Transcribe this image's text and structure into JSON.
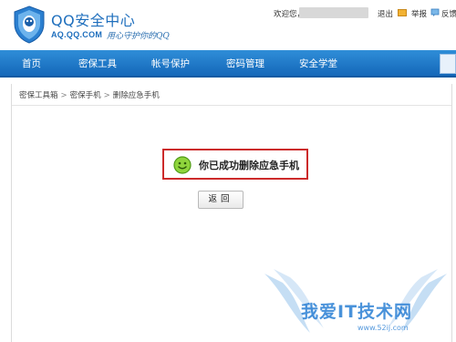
{
  "header": {
    "title": "QQ安全中心",
    "domain": "AQ.QQ.COM",
    "slogan": "用心守护你的QQ",
    "welcome": "欢迎您，",
    "logout": "退出",
    "report": "举报",
    "feedback": "反馈建议"
  },
  "nav": {
    "items": [
      {
        "label": "首页"
      },
      {
        "label": "密保工具"
      },
      {
        "label": "帐号保护"
      },
      {
        "label": "密码管理"
      },
      {
        "label": "安全学堂"
      }
    ]
  },
  "breadcrumb": {
    "items": [
      "密保工具箱",
      "密保手机",
      "删除应急手机"
    ],
    "separator": ">"
  },
  "result": {
    "message": "你已成功删除应急手机",
    "icon": "smile-icon"
  },
  "back_button": {
    "label": "返回"
  },
  "watermark": {
    "text": "我爱IT技术网",
    "url": "www.52ij.com"
  },
  "colors": {
    "nav_blue": "#1f77c9",
    "brand_blue": "#1f6fbd",
    "highlight_red": "#cc2a2a",
    "smile_green": "#6fbf2a"
  }
}
